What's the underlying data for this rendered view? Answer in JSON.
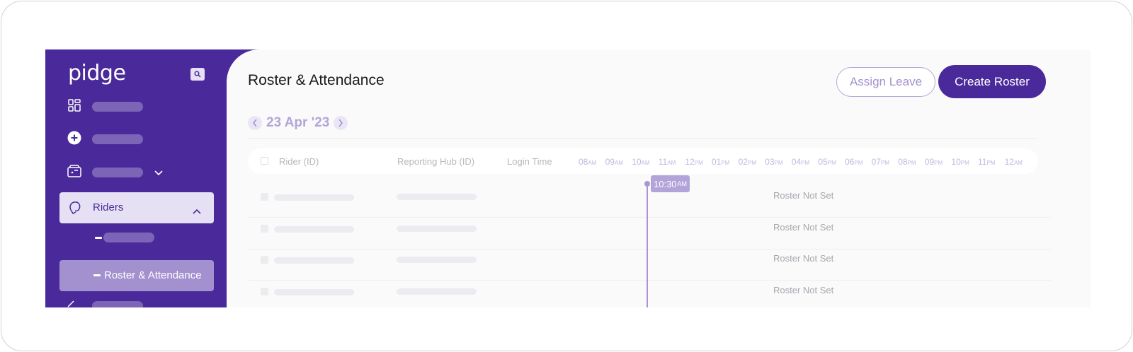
{
  "sidebar": {
    "logo": "pidge",
    "riders_label": "Riders",
    "roster_label": "Roster & Attendance"
  },
  "header": {
    "title": "Roster & Attendance",
    "assign_leave_label": "Assign Leave",
    "create_roster_label": "Create Roster"
  },
  "date": {
    "label": "23 Apr '23"
  },
  "table": {
    "columns": [
      "Rider (ID)",
      "Reporting Hub (ID)",
      "Login Time"
    ],
    "hours": [
      {
        "h": "08",
        "ap": "AM"
      },
      {
        "h": "09",
        "ap": "AM"
      },
      {
        "h": "10",
        "ap": "AM"
      },
      {
        "h": "11",
        "ap": "AM"
      },
      {
        "h": "12",
        "ap": "PM"
      },
      {
        "h": "01",
        "ap": "PM"
      },
      {
        "h": "02",
        "ap": "PM"
      },
      {
        "h": "03",
        "ap": "PM"
      },
      {
        "h": "04",
        "ap": "PM"
      },
      {
        "h": "05",
        "ap": "PM"
      },
      {
        "h": "06",
        "ap": "PM"
      },
      {
        "h": "07",
        "ap": "PM"
      },
      {
        "h": "08",
        "ap": "PM"
      },
      {
        "h": "09",
        "ap": "PM"
      },
      {
        "h": "10",
        "ap": "PM"
      },
      {
        "h": "11",
        "ap": "PM"
      },
      {
        "h": "12",
        "ap": "AM"
      }
    ],
    "rows": [
      {
        "status": "Roster Not Set"
      },
      {
        "status": "Roster Not Set"
      },
      {
        "status": "Roster Not Set"
      },
      {
        "status": "Roster Not Set"
      }
    ]
  },
  "current_time": {
    "time": "10:30",
    "ap": "AM"
  },
  "colors": {
    "brand": "#4a2a9a",
    "accent_light": "#a996d3"
  }
}
